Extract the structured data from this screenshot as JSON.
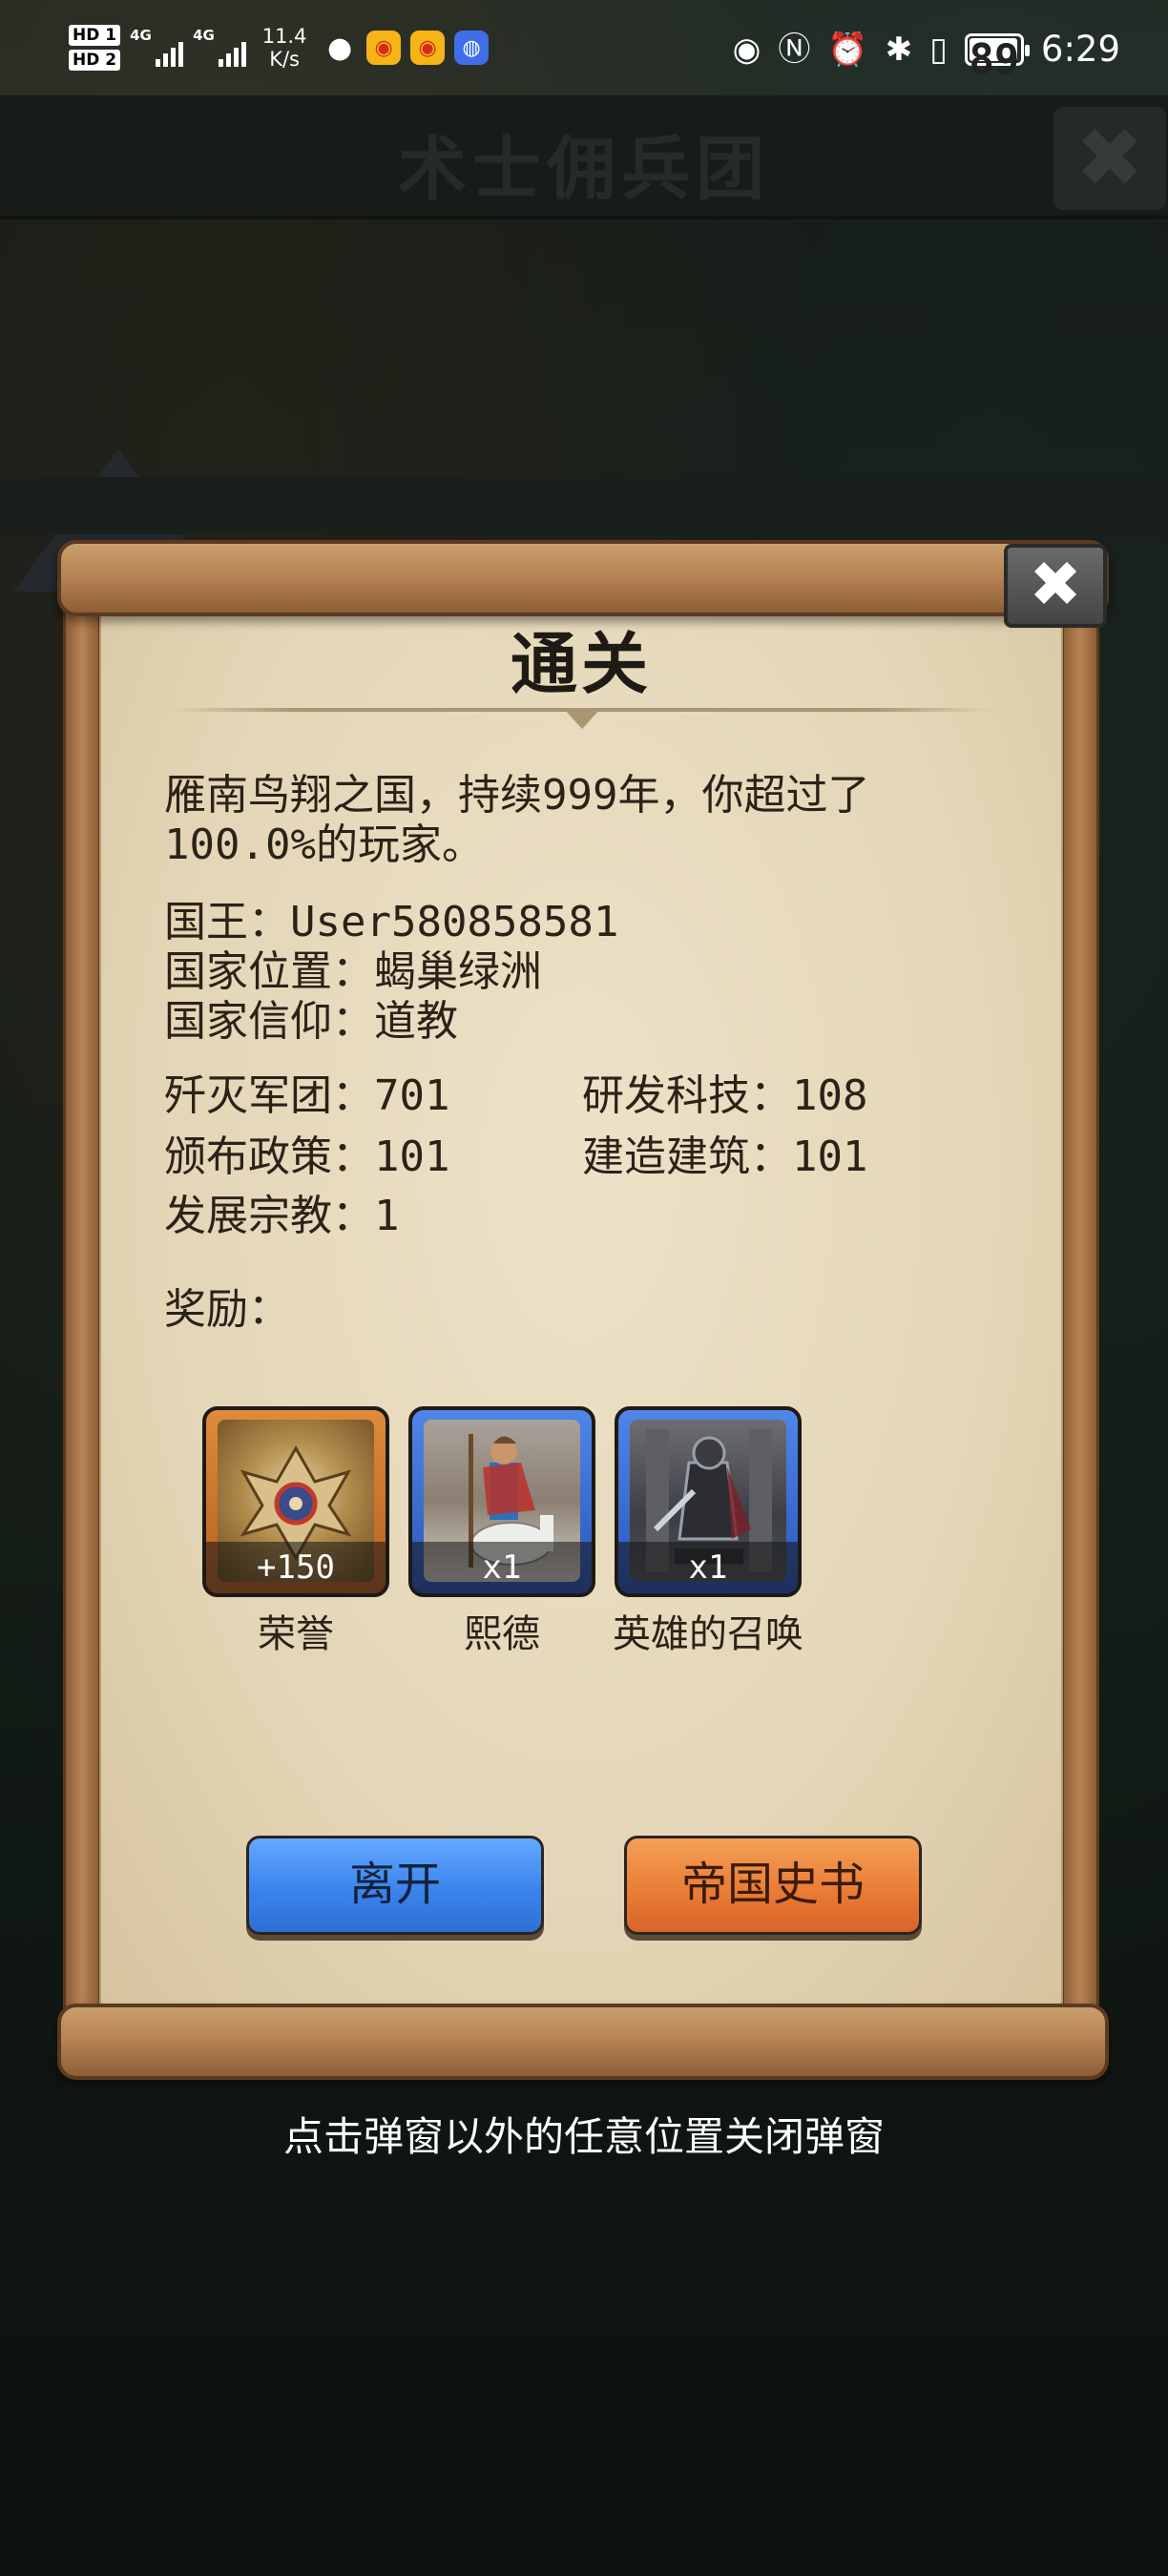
{
  "status_bar": {
    "hd1": "HD 1",
    "hd2": "HD 2",
    "network1": "4G",
    "network2": "4G",
    "speed_value": "11.4",
    "speed_unit": "K/s",
    "battery": "89",
    "time": "6:29",
    "icons": [
      "wechat-icon",
      "weibo-icon",
      "weibo-icon",
      "bulb-icon",
      "eye-icon",
      "nfc-icon",
      "alarm-icon",
      "bluetooth-icon",
      "vibrate-icon"
    ]
  },
  "background": {
    "title": "术士佣兵团",
    "close_symbol": "✖"
  },
  "dialog": {
    "title": "通关",
    "close_symbol": "✖",
    "summary": "雁南鸟翔之国，持续999年，你超过了100.0%的玩家。",
    "king_label": "国王：",
    "king_value": "User580858581",
    "location_label": "国家位置：",
    "location_value": "蝎巢绿洲",
    "faith_label": "国家信仰：",
    "faith_value": "道教",
    "stats": {
      "legions_label": "歼灭军团：",
      "legions_value": "701",
      "tech_label": "研发科技：",
      "tech_value": "108",
      "policy_label": "颁布政策：",
      "policy_value": "101",
      "building_label": "建造建筑：",
      "building_value": "101",
      "religion_label": "发展宗教：",
      "religion_value": "1"
    },
    "rewards_label": "奖励：",
    "rewards": [
      {
        "name": "荣誉",
        "qty": "+150",
        "frame_color": "#e08a3a",
        "icon": "honor-emblem-icon"
      },
      {
        "name": "熙德",
        "qty": "x1",
        "frame_color": "#4f86e8",
        "icon": "knight-on-horse-icon"
      },
      {
        "name": "英雄的召唤",
        "qty": "x1",
        "frame_color": "#4f86e8",
        "icon": "armored-hero-icon"
      }
    ],
    "buttons": {
      "leave": "离开",
      "history": "帝国史书"
    }
  },
  "hint": "点击弹窗以外的任意位置关闭弹窗",
  "colors": {
    "leave_button": "#3b84ec",
    "history_button": "#eb7d35",
    "paper": "#e4d6b7",
    "scroll_wood": "#b88455"
  }
}
